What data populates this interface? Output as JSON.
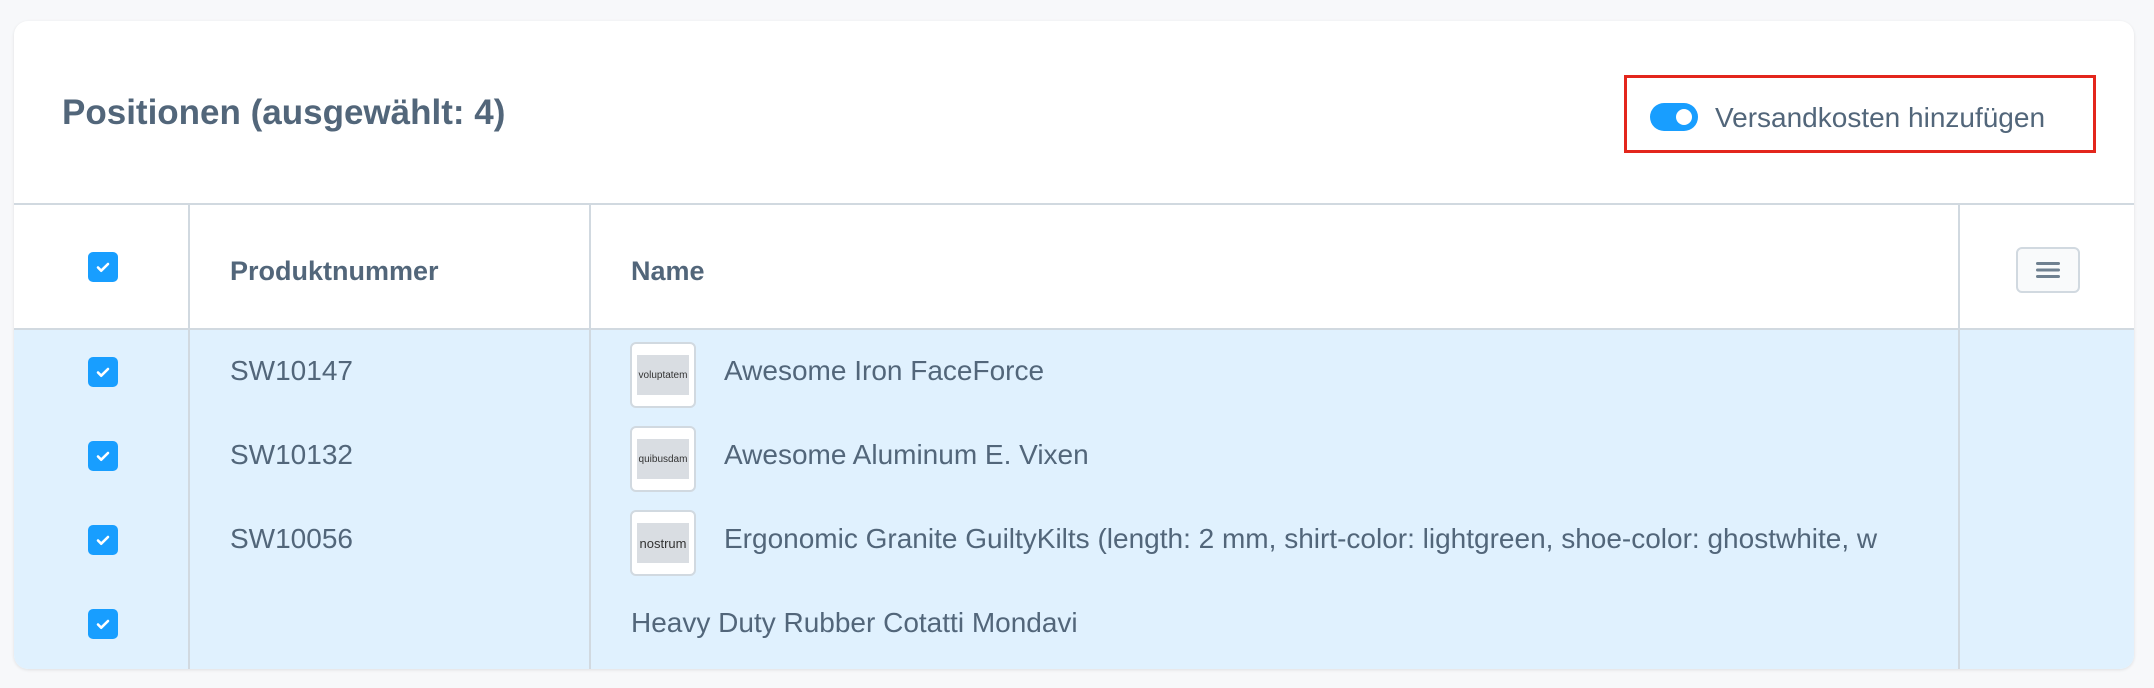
{
  "header": {
    "title": "Positionen (ausgewählt: 4)",
    "shipping_toggle": {
      "label": "Versandkosten hinzufügen",
      "checked": true
    }
  },
  "grid": {
    "columns": {
      "number": "Produktnummer",
      "name": "Name"
    },
    "settings_icon": "hamburger-menu-icon",
    "rows": [
      {
        "selected": true,
        "number": "SW10147",
        "thumb_text": "voluptatem",
        "name": "Awesome Iron FaceForce"
      },
      {
        "selected": true,
        "number": "SW10132",
        "thumb_text": "quibusdam",
        "name": "Awesome Aluminum E. Vixen"
      },
      {
        "selected": true,
        "number": "SW10056",
        "thumb_text": "nostrum",
        "name": "Ergonomic Granite GuiltyKilts (length: 2 mm, shirt-color: lightgreen, shoe-color: ghostwhite, w"
      },
      {
        "selected": true,
        "number": "",
        "thumb_text": "",
        "name": "Heavy Duty Rubber Cotatti Mondavi"
      }
    ]
  },
  "colors": {
    "accent": "#189eff",
    "selected_row_bg": "#e0f1fe",
    "highlight_border": "#e3261c",
    "text": "#52667a"
  }
}
